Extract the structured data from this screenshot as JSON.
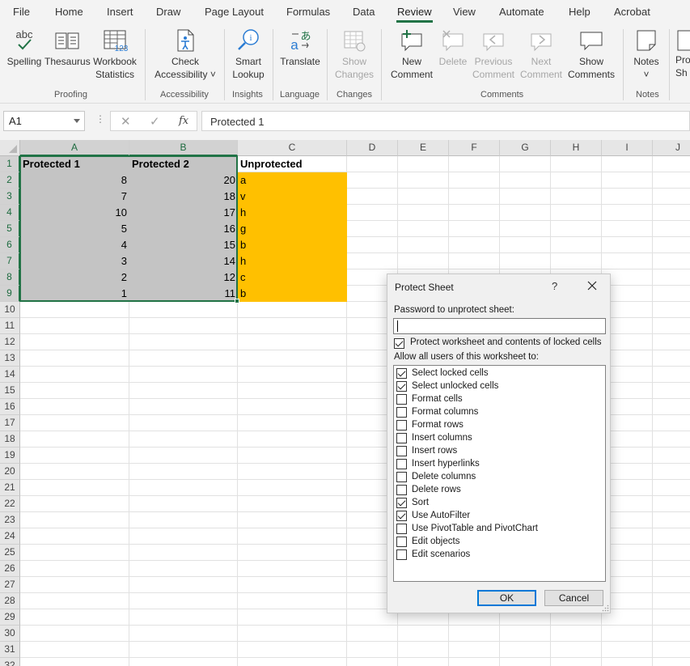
{
  "tabs": [
    {
      "label": "File",
      "active": false
    },
    {
      "label": "Home",
      "active": false
    },
    {
      "label": "Insert",
      "active": false
    },
    {
      "label": "Draw",
      "active": false
    },
    {
      "label": "Page Layout",
      "active": false
    },
    {
      "label": "Formulas",
      "active": false
    },
    {
      "label": "Data",
      "active": false
    },
    {
      "label": "Review",
      "active": true
    },
    {
      "label": "View",
      "active": false
    },
    {
      "label": "Automate",
      "active": false
    },
    {
      "label": "Help",
      "active": false
    },
    {
      "label": "Acrobat",
      "active": false
    }
  ],
  "ribbon": {
    "buttons": [
      {
        "label1": "Spelling",
        "label2": "",
        "icon": "spelling-icon",
        "enabled": true
      },
      {
        "label1": "Thesaurus",
        "label2": "",
        "icon": "thesaurus-icon",
        "enabled": true
      },
      {
        "label1": "Workbook",
        "label2": "Statistics",
        "icon": "workbook-statistics-icon",
        "enabled": true
      },
      {
        "label1": "Check",
        "label2": "Accessibility ˅",
        "icon": "accessibility-icon",
        "enabled": true
      },
      {
        "label1": "Smart",
        "label2": "Lookup",
        "icon": "smart-lookup-icon",
        "enabled": true
      },
      {
        "label1": "Translate",
        "label2": "",
        "icon": "translate-icon",
        "enabled": true
      },
      {
        "label1": "Show",
        "label2": "Changes",
        "icon": "show-changes-icon",
        "enabled": false
      },
      {
        "label1": "New",
        "label2": "Comment",
        "icon": "new-comment-icon",
        "enabled": true
      },
      {
        "label1": "Delete",
        "label2": "",
        "icon": "delete-comment-icon",
        "enabled": false
      },
      {
        "label1": "Previous",
        "label2": "Comment",
        "icon": "previous-comment-icon",
        "enabled": false
      },
      {
        "label1": "Next",
        "label2": "Comment",
        "icon": "next-comment-icon",
        "enabled": false
      },
      {
        "label1": "Show",
        "label2": "Comments",
        "icon": "show-comments-icon",
        "enabled": true
      },
      {
        "label1": "Notes",
        "label2": "˅",
        "icon": "notes-icon",
        "enabled": true
      },
      {
        "label1": "Pro",
        "label2": "Sh",
        "icon": "protect-sheet-icon",
        "enabled": true
      }
    ],
    "groups": [
      "Proofing",
      "Accessibility",
      "Insights",
      "Language",
      "Changes",
      "Comments",
      "Notes"
    ]
  },
  "formula_bar": {
    "name_box": "A1",
    "fx_label": "fx",
    "content": "Protected 1"
  },
  "sheet": {
    "columns": [
      "A",
      "B",
      "C",
      "D",
      "E",
      "F",
      "G",
      "H",
      "I",
      "J"
    ],
    "selected_columns": [
      "A",
      "B"
    ],
    "rows": [
      "1",
      "2",
      "3",
      "4",
      "5",
      "6",
      "7",
      "8",
      "9",
      "10",
      "11",
      "12",
      "13",
      "14",
      "15",
      "16",
      "17",
      "18",
      "19",
      "20",
      "21",
      "22",
      "23",
      "24",
      "25",
      "26",
      "27",
      "28",
      "29",
      "30",
      "31",
      "32"
    ],
    "headers": {
      "a": "Protected 1",
      "b": "Protected 2",
      "c": "Unprotected"
    },
    "data": [
      {
        "a": "8",
        "b": "20",
        "c": "a"
      },
      {
        "a": "7",
        "b": "18",
        "c": "v"
      },
      {
        "a": "10",
        "b": "17",
        "c": "h"
      },
      {
        "a": "5",
        "b": "16",
        "c": "g"
      },
      {
        "a": "4",
        "b": "15",
        "c": "b"
      },
      {
        "a": "3",
        "b": "14",
        "c": "h"
      },
      {
        "a": "2",
        "b": "12",
        "c": "c"
      },
      {
        "a": "1",
        "b": "11",
        "c": "b"
      }
    ],
    "colors": {
      "protected_fill": "#c4c4c4",
      "unprotected_fill": "#ffc000",
      "selection": "#217346"
    }
  },
  "dialog": {
    "title": "Protect Sheet",
    "help": "?",
    "password_label": "Password to unprotect sheet:",
    "password_value": "",
    "protect_label": "Protect worksheet and contents of locked cells",
    "protect_checked": true,
    "allow_label": "Allow all users of this worksheet to:",
    "permissions": [
      {
        "label": "Select locked cells",
        "checked": true
      },
      {
        "label": "Select unlocked cells",
        "checked": true
      },
      {
        "label": "Format cells",
        "checked": false
      },
      {
        "label": "Format columns",
        "checked": false
      },
      {
        "label": "Format rows",
        "checked": false
      },
      {
        "label": "Insert columns",
        "checked": false
      },
      {
        "label": "Insert rows",
        "checked": false
      },
      {
        "label": "Insert hyperlinks",
        "checked": false
      },
      {
        "label": "Delete columns",
        "checked": false
      },
      {
        "label": "Delete rows",
        "checked": false
      },
      {
        "label": "Sort",
        "checked": true
      },
      {
        "label": "Use AutoFilter",
        "checked": true
      },
      {
        "label": "Use PivotTable and PivotChart",
        "checked": false
      },
      {
        "label": "Edit objects",
        "checked": false
      },
      {
        "label": "Edit scenarios",
        "checked": false
      }
    ],
    "ok_label": "OK",
    "cancel_label": "Cancel"
  }
}
